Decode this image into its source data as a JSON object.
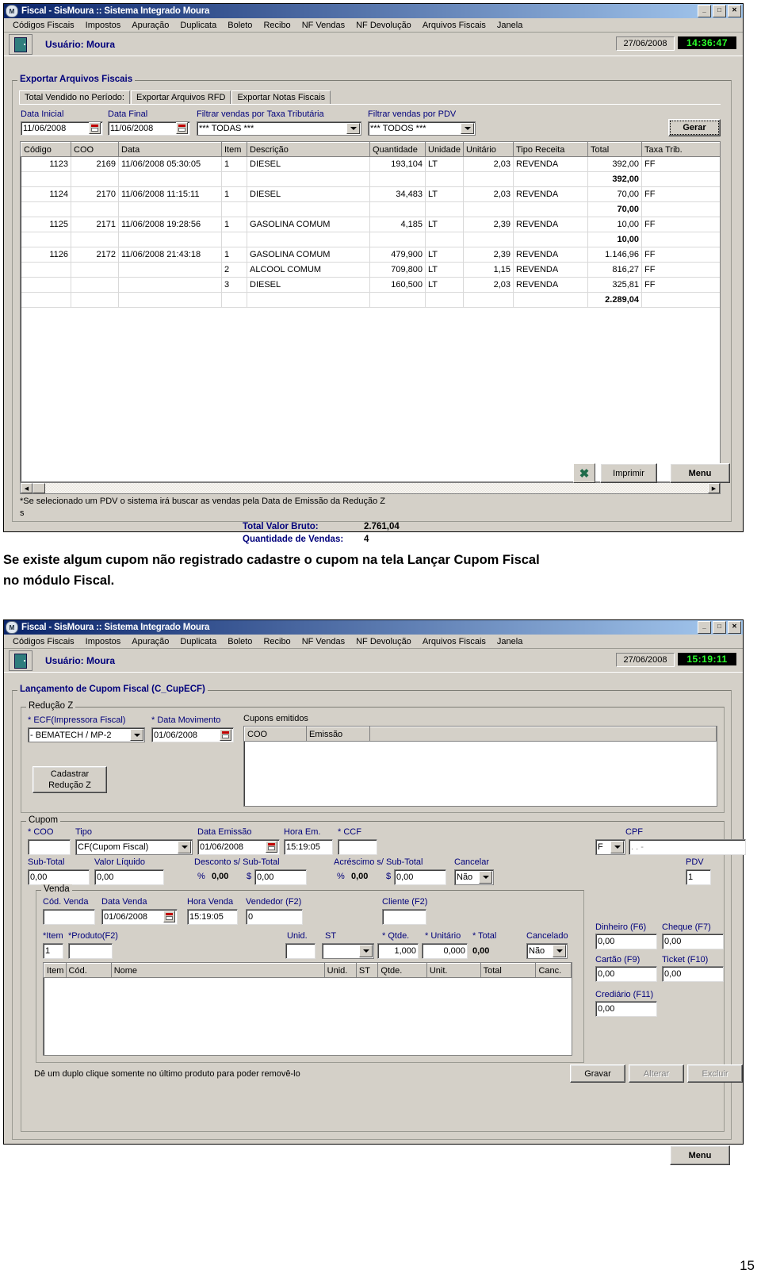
{
  "window1": {
    "title": "Fiscal - SisMoura :: Sistema Integrado Moura",
    "titlebar_buttons": [
      "_",
      "□",
      "✕"
    ],
    "menu": [
      "Códigos Fiscais",
      "Impostos",
      "Apuração",
      "Duplicata",
      "Boleto",
      "Recibo",
      "NF Vendas",
      "NF Devolução",
      "Arquivos Fiscais",
      "Janela"
    ],
    "user_label": "Usuário: Moura",
    "date": "27/06/2008",
    "time": "14:36:47",
    "group_title": "Exportar Arquivos Fiscais",
    "tabs": [
      {
        "label": "Total Vendido no Período:",
        "active": true
      },
      {
        "label": "Exportar Arquivos RFD",
        "active": false
      },
      {
        "label": "Exportar Notas Fiscais",
        "active": false
      }
    ],
    "filters": {
      "data_inicial_label": "Data Inicial",
      "data_inicial_value": "11/06/2008",
      "data_final_label": "Data Final",
      "data_final_value": "11/06/2008",
      "taxa_label": "Filtrar vendas por Taxa Tributária",
      "taxa_value": "*** TODAS ***",
      "pdv_label": "Filtrar vendas por PDV",
      "pdv_value": "*** TODOS ***",
      "gerar_button": "Gerar"
    },
    "grid": {
      "columns": [
        "Código",
        "COO",
        "Data",
        "Item",
        "Descrição",
        "Quantidade",
        "Unidade",
        "Unitário",
        "Tipo Receita",
        "Total",
        "Taxa Trib."
      ],
      "rows": [
        {
          "codigo": "1123",
          "coo": "2169",
          "data": "11/06/2008 05:30:05",
          "item": "1",
          "descricao": "DIESEL",
          "quantidade": "193,104",
          "unidade": "LT",
          "unitario": "2,03",
          "tipo": "REVENDA",
          "total": "392,00",
          "taxa": "FF",
          "subtotal": false
        },
        {
          "codigo": "",
          "coo": "",
          "data": "",
          "item": "",
          "descricao": "",
          "quantidade": "",
          "unidade": "",
          "unitario": "",
          "tipo": "",
          "total": "392,00",
          "taxa": "",
          "subtotal": true
        },
        {
          "codigo": "1124",
          "coo": "2170",
          "data": "11/06/2008 11:15:11",
          "item": "1",
          "descricao": "DIESEL",
          "quantidade": "34,483",
          "unidade": "LT",
          "unitario": "2,03",
          "tipo": "REVENDA",
          "total": "70,00",
          "taxa": "FF",
          "subtotal": false
        },
        {
          "codigo": "",
          "coo": "",
          "data": "",
          "item": "",
          "descricao": "",
          "quantidade": "",
          "unidade": "",
          "unitario": "",
          "tipo": "",
          "total": "70,00",
          "taxa": "",
          "subtotal": true
        },
        {
          "codigo": "1125",
          "coo": "2171",
          "data": "11/06/2008 19:28:56",
          "item": "1",
          "descricao": "GASOLINA COMUM",
          "quantidade": "4,185",
          "unidade": "LT",
          "unitario": "2,39",
          "tipo": "REVENDA",
          "total": "10,00",
          "taxa": "FF",
          "subtotal": false
        },
        {
          "codigo": "",
          "coo": "",
          "data": "",
          "item": "",
          "descricao": "",
          "quantidade": "",
          "unidade": "",
          "unitario": "",
          "tipo": "",
          "total": "10,00",
          "taxa": "",
          "subtotal": true
        },
        {
          "codigo": "1126",
          "coo": "2172",
          "data": "11/06/2008 21:43:18",
          "item": "1",
          "descricao": "GASOLINA COMUM",
          "quantidade": "479,900",
          "unidade": "LT",
          "unitario": "2,39",
          "tipo": "REVENDA",
          "total": "1.146,96",
          "taxa": "FF",
          "subtotal": false
        },
        {
          "codigo": "",
          "coo": "",
          "data": "",
          "item": "2",
          "descricao": "ALCOOL COMUM",
          "quantidade": "709,800",
          "unidade": "LT",
          "unitario": "1,15",
          "tipo": "REVENDA",
          "total": "816,27",
          "taxa": "FF",
          "subtotal": false
        },
        {
          "codigo": "",
          "coo": "",
          "data": "",
          "item": "3",
          "descricao": "DIESEL",
          "quantidade": "160,500",
          "unidade": "LT",
          "unitario": "2,03",
          "tipo": "REVENDA",
          "total": "325,81",
          "taxa": "FF",
          "subtotal": false
        },
        {
          "codigo": "",
          "coo": "",
          "data": "",
          "item": "",
          "descricao": "",
          "quantidade": "",
          "unidade": "",
          "unitario": "",
          "tipo": "",
          "total": "2.289,04",
          "taxa": "",
          "subtotal": true
        }
      ]
    },
    "footer_note_line1": "*Se selecionado um PDV o sistema irá buscar as vendas pela Data de Emissão da Redução Z",
    "footer_note_line2": "s",
    "totals": {
      "bruto_label": "Total Valor Bruto:",
      "bruto_value": "2.761,04",
      "qtd_label": "Quantidade de Vendas:",
      "qtd_value": "4"
    },
    "buttons": {
      "excel_icon": "excel-icon",
      "imprimir": "Imprimir",
      "menu": "Menu"
    }
  },
  "caption": {
    "line1": "Se existe algum cupom não registrado cadastre o cupom na tela Lançar Cupom Fiscal",
    "line2": "no módulo Fiscal."
  },
  "window2": {
    "title": "Fiscal - SisMoura :: Sistema Integrado Moura",
    "titlebar_buttons": [
      "_",
      "□",
      "✕"
    ],
    "menu": [
      "Códigos Fiscais",
      "Impostos",
      "Apuração",
      "Duplicata",
      "Boleto",
      "Recibo",
      "NF Vendas",
      "NF Devolução",
      "Arquivos Fiscais",
      "Janela"
    ],
    "user_label": "Usuário: Moura",
    "date": "27/06/2008",
    "time": "15:19:11",
    "group_title": "Lançamento de Cupom Fiscal (C_CupECF)",
    "reducao": {
      "legend": "Redução Z",
      "ecf_label": "* ECF(Impressora Fiscal)",
      "ecf_value": "- BEMATECH / MP-2",
      "data_label": "* Data Movimento",
      "data_value": "01/06/2008",
      "cadastrar_button": "Cadastrar\nRedução Z",
      "cadastrar_line1": "Cadastrar",
      "cadastrar_line2": "Redução Z",
      "cupons_label": "Cupons emitidos",
      "cupons_columns": [
        "COO",
        "Emissão"
      ],
      "cupons_rows": []
    },
    "cupom": {
      "legend": "Cupom",
      "coo_label": "* COO",
      "coo_value": "",
      "tipo_label": "Tipo",
      "tipo_value": "CF(Cupom Fiscal)",
      "data_emissao_label": "Data Emissão",
      "data_emissao_value": "01/06/2008",
      "hora_label": "Hora Em.",
      "hora_value": "15:19:05",
      "ccf_label": "* CCF",
      "ccf_value": "",
      "cpf_label": "CPF",
      "cpf_tipo_value": "F",
      "cpf_value": ".   .   -",
      "subtotal_label": "Sub-Total",
      "subtotal_value": "0,00",
      "liquido_label": "Valor Líquido",
      "liquido_value": "0,00",
      "desconto_label": "Desconto s/ Sub-Total",
      "desconto_pct_sym": "%",
      "desconto_pct": "0,00",
      "desconto_cur_sym": "$",
      "desconto_val": "0,00",
      "acrescimo_label": "Acréscimo s/ Sub-Total",
      "acrescimo_pct_sym": "%",
      "acrescimo_pct": "0,00",
      "acrescimo_cur_sym": "$",
      "acrescimo_val": "0,00",
      "cancelar_label": "Cancelar",
      "cancelar_value": "Não",
      "pdv_label": "PDV",
      "pdv_value": "1"
    },
    "venda": {
      "legend": "Venda",
      "cod_label": "Cód. Venda",
      "cod_value": "",
      "data_label": "Data Venda",
      "data_value": "01/06/2008",
      "hora_label": "Hora Venda",
      "hora_value": "15:19:05",
      "vendedor_label": "Vendedor (F2)",
      "vendedor_value": "0",
      "cliente_label": "Cliente (F2)",
      "cliente_value": "",
      "item_label": "*Item",
      "item_value": "1",
      "produto_label": "*Produto(F2)",
      "produto_value": "",
      "unid_label": "Unid.",
      "unid_value": "",
      "st_label": "ST",
      "st_value": "",
      "qtde_label": "* Qtde.",
      "qtde_value": "1,000",
      "unitario_label": "* Unitário",
      "unitario_value": "0,000",
      "total_label": "* Total",
      "total_value": "0,00",
      "cancelado_label": "Cancelado",
      "cancelado_value": "Não",
      "grid_columns": [
        "Item",
        "Cód.",
        "Nome",
        "Unid.",
        "ST",
        "Qtde.",
        "Unit.",
        "Total",
        "Canc."
      ],
      "grid_rows": []
    },
    "pagamento": {
      "dinheiro_label": "Dinheiro (F6)",
      "dinheiro_value": "0,00",
      "cheque_label": "Cheque (F7)",
      "cheque_value": "0,00",
      "cartao_label": "Cartão (F9)",
      "cartao_value": "0,00",
      "ticket_label": "Ticket (F10)",
      "ticket_value": "0,00",
      "crediario_label": "Crediário (F11)",
      "crediario_value": "0,00"
    },
    "hint": "Dê um duplo clique somente no último produto para poder removê-lo",
    "buttons": {
      "gravar": "Gravar",
      "alterar": "Alterar",
      "excluir": "Excluir",
      "menu": "Menu"
    }
  },
  "page_number": "15"
}
